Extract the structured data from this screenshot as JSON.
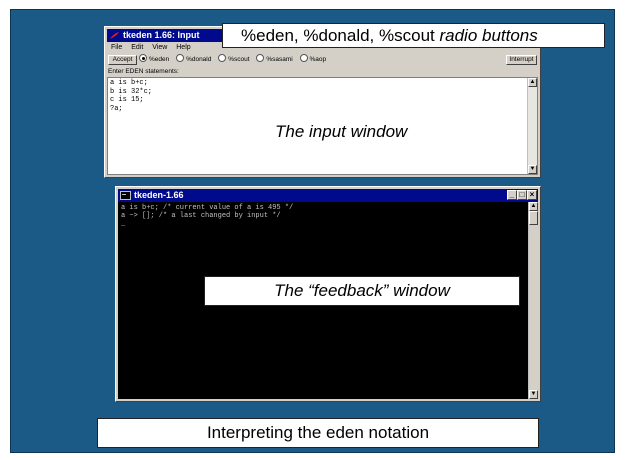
{
  "input_window": {
    "title": "tkeden 1.66: Input",
    "menu": [
      "File",
      "Edit",
      "View",
      "Help"
    ],
    "accept_label": "Accept",
    "interrupt_label": "Interrupt",
    "radios": [
      {
        "label": "%eden",
        "selected": true
      },
      {
        "label": "%donald",
        "selected": false
      },
      {
        "label": "%scout",
        "selected": false
      },
      {
        "label": "%sasami",
        "selected": false
      },
      {
        "label": "%aop",
        "selected": false
      }
    ],
    "prompt": "Enter EDEN statements:",
    "code": "a is b+c;\nb is 32*c;\nc is 15;\n?a;"
  },
  "feedback_window": {
    "title": "tkeden-1.66",
    "output": "a is b+c; /* current value of a is 495 */\na ~> []; /* a last changed by input */\n_"
  },
  "annotations": {
    "radio_caption_prefix": "%eden, %donald, %scout ",
    "radio_caption_suffix": "radio buttons",
    "input_caption": "The input window",
    "feedback_caption": "The “feedback” window",
    "footer": "Interpreting the eden notation"
  },
  "colors": {
    "slide_bg": "#1b5a86",
    "titlebar": "#000a8c",
    "console_bg": "#000000",
    "console_text": "#c0c0c0"
  }
}
